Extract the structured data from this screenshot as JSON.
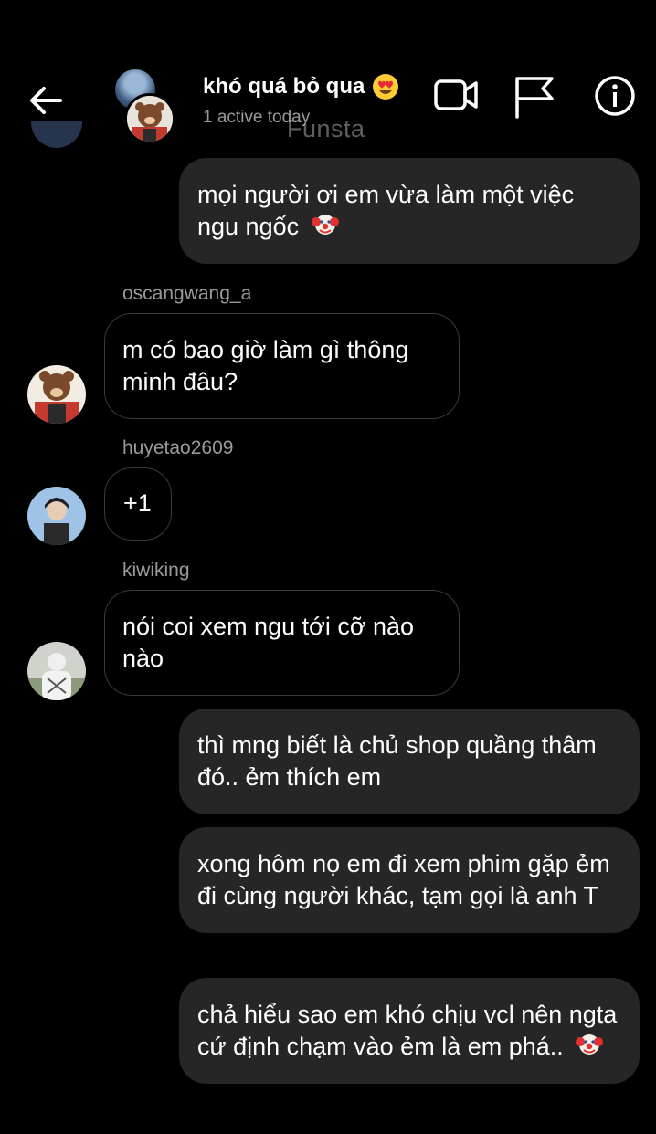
{
  "header": {
    "title": "khó quá bỏ qua",
    "title_emoji": "heart-eyes-emoji",
    "status": "1 active today",
    "watermark": "Funsta"
  },
  "messages": [
    {
      "direction": "sent",
      "text": "mọi người ơi em vừa làm một việc ngu ngốc",
      "emoji": "clown-emoji"
    },
    {
      "direction": "received",
      "username": "oscangwang_a",
      "text": "m có bao giờ làm gì thông minh đâu?"
    },
    {
      "direction": "received",
      "username": "huyetao2609",
      "text": "+1"
    },
    {
      "direction": "received",
      "username": "kiwiking",
      "text": "nói coi xem ngu tới cỡ nào nào"
    },
    {
      "direction": "sent",
      "text": "thì mng biết là chủ shop quầng thâm đó.. ẻm thích em"
    },
    {
      "direction": "sent",
      "text": "xong hôm nọ em đi xem phim gặp ẻm đi cùng người khác, tạm gọi là anh T"
    },
    {
      "direction": "sent",
      "text": "chả hiểu sao em khó chịu vcl nên ngta cứ định chạm vào ẻm là em phá..",
      "emoji": "clown-emoji"
    }
  ],
  "colors": {
    "background": "#000000",
    "sent_bubble": "#262626",
    "received_border": "#3a3a3a",
    "secondary_text": "#9a9a9a"
  }
}
